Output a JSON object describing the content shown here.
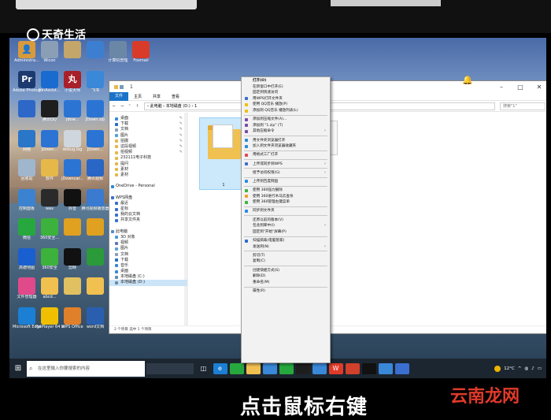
{
  "watermark": {
    "top_left": "天奇生活",
    "bottom_right": "云南龙网"
  },
  "caption": "点击鼠标右键",
  "desktop_icons": [
    {
      "label": "Administra...",
      "color": "#d89a3a",
      "glyph": "👤",
      "col": 0,
      "row": 0
    },
    {
      "label": "Wicon",
      "color": "#8a9fb5",
      "glyph": "",
      "col": 1,
      "row": 0
    },
    {
      "label": "",
      "color": "#c4a56a",
      "glyph": "",
      "col": 2,
      "row": 0
    },
    {
      "label": "",
      "color": "#3c7fd0",
      "glyph": "",
      "col": 3,
      "row": 0
    },
    {
      "label": "计算机管理",
      "color": "#6b87a6",
      "glyph": "",
      "col": 4,
      "row": 0
    },
    {
      "label": "Foxmail",
      "color": "#d83b2a",
      "glyph": "",
      "col": 5,
      "row": 0
    },
    {
      "label": "Adobe Photosho...",
      "color": "#1d3a70",
      "glyph": "Pr",
      "col": 0,
      "row": 1
    },
    {
      "label": "JdnAssist...",
      "color": "#1a6bd0",
      "glyph": "",
      "col": 1,
      "row": 1
    },
    {
      "label": "小说大师",
      "color": "#a8202a",
      "glyph": "丸",
      "col": 2,
      "row": 1
    },
    {
      "label": "飞书",
      "color": "#3a88d8",
      "glyph": "",
      "col": 3,
      "row": 1
    },
    {
      "label": "",
      "color": "#2d68c8",
      "glyph": "",
      "col": 0,
      "row": 2
    },
    {
      "label": "腾讯QQ",
      "color": "#1e1e1e",
      "glyph": "",
      "col": 1,
      "row": 2
    },
    {
      "label": "jdow...",
      "color": "#2b74d4",
      "glyph": "",
      "col": 2,
      "row": 2
    },
    {
      "label": "JDown.zip",
      "color": "#2b74d4",
      "glyph": "",
      "col": 3,
      "row": 2
    },
    {
      "label": "网络",
      "color": "#2a76c8",
      "glyph": "",
      "col": 0,
      "row": 3
    },
    {
      "label": "JDown...",
      "color": "#2b74d4",
      "glyph": "",
      "col": 1,
      "row": 3
    },
    {
      "label": "debug.log",
      "color": "#cfd6de",
      "glyph": "",
      "col": 2,
      "row": 3
    },
    {
      "label": "JDown...",
      "color": "#2b74d4",
      "glyph": "",
      "col": 3,
      "row": 3
    },
    {
      "label": "回收站",
      "color": "#9fb6cc",
      "glyph": "",
      "col": 0,
      "row": 4
    },
    {
      "label": "软件",
      "color": "#e6b84a",
      "glyph": "",
      "col": 1,
      "row": 4
    },
    {
      "label": "JDowncar...",
      "color": "#2b74d4",
      "glyph": "",
      "col": 2,
      "row": 4
    },
    {
      "label": "腾讯视频",
      "color": "#2a66c6",
      "glyph": "",
      "col": 3,
      "row": 4
    },
    {
      "label": "控制面板",
      "color": "#3b83d0",
      "glyph": "",
      "col": 0,
      "row": 5
    },
    {
      "label": "wav",
      "color": "#2a2a2a",
      "glyph": "",
      "col": 1,
      "row": 5
    },
    {
      "label": "抖音",
      "color": "#111111",
      "glyph": "",
      "col": 2,
      "row": 5
    },
    {
      "label": "腾讯视频播放器",
      "color": "#3a7ad0",
      "glyph": "",
      "col": 3,
      "row": 5
    },
    {
      "label": "微信",
      "color": "#27a83e",
      "glyph": "",
      "col": 0,
      "row": 6
    },
    {
      "label": "360安全...",
      "color": "#3cb23c",
      "glyph": "",
      "col": 1,
      "row": 6
    },
    {
      "label": "",
      "color": "#e0a020",
      "glyph": "",
      "col": 2,
      "row": 6
    },
    {
      "label": "",
      "color": "#e0a020",
      "glyph": "",
      "col": 3,
      "row": 6
    },
    {
      "label": "高德地图",
      "color": "#1a5fd0",
      "glyph": "",
      "col": 0,
      "row": 7
    },
    {
      "label": "360安全",
      "color": "#3cb23c",
      "glyph": "",
      "col": 1,
      "row": 7
    },
    {
      "label": "剪映",
      "color": "#111111",
      "glyph": "",
      "col": 2,
      "row": 7
    },
    {
      "label": "",
      "color": "#2a9a3a",
      "glyph": "",
      "col": 3,
      "row": 7
    },
    {
      "label": "文件管理器",
      "color": "#e04a8a",
      "glyph": "",
      "col": 0,
      "row": 8
    },
    {
      "label": "abcd...",
      "color": "#f0c050",
      "glyph": "",
      "col": 1,
      "row": 8
    },
    {
      "label": "",
      "color": "#e0c060",
      "glyph": "",
      "col": 2,
      "row": 8
    },
    {
      "label": "",
      "color": "#f0c050",
      "glyph": "",
      "col": 3,
      "row": 8
    },
    {
      "label": "Microsoft Edge",
      "color": "#1b7fd4",
      "glyph": "",
      "col": 0,
      "row": 9
    },
    {
      "label": "PotPlayer 64 bit",
      "color": "#f0c000",
      "glyph": "",
      "col": 1,
      "row": 9
    },
    {
      "label": "WPS Office",
      "color": "#e0802a",
      "glyph": "",
      "col": 2,
      "row": 9
    },
    {
      "label": "word文档",
      "color": "#2a5fb0",
      "glyph": "",
      "col": 3,
      "row": 9
    }
  ],
  "explorer": {
    "title": "1",
    "ribbon_tabs": [
      "文件",
      "主页",
      "共享",
      "查看"
    ],
    "address_path": "› 此电脑 › 本地磁盘 (D:) › 1",
    "search_placeholder": "搜索\"1\"",
    "nav_items": [
      {
        "label": "桌面",
        "color": "#3a88d8",
        "sec": false,
        "pin": true
      },
      {
        "label": "下载",
        "color": "#2a6bc8",
        "sec": false,
        "pin": true
      },
      {
        "label": "文档",
        "color": "#8a9fb5",
        "sec": false,
        "pin": true
      },
      {
        "label": "图片",
        "color": "#5aa0d8",
        "sec": false,
        "pin": true
      },
      {
        "label": "拍摄",
        "color": "#e6b84a",
        "sec": false,
        "pin": true
      },
      {
        "label": "这段视频",
        "color": "#e6b84a",
        "sec": false,
        "pin": true
      },
      {
        "label": "拍视频",
        "color": "#e6b84a",
        "sec": false,
        "pin": true
      },
      {
        "label": "232111电子科技",
        "color": "#e6b84a",
        "sec": false,
        "pin": false
      },
      {
        "label": "提问",
        "color": "#e6b84a",
        "sec": false,
        "pin": false
      },
      {
        "label": "素材",
        "color": "#e6b84a",
        "sec": false,
        "pin": false
      },
      {
        "label": "素材",
        "color": "#e6b84a",
        "sec": false,
        "pin": false
      },
      {
        "label": "",
        "color": "transparent",
        "sec": false,
        "pin": false
      },
      {
        "label": "OneDrive - Personal",
        "color": "#2a8ad8",
        "sec": true,
        "pin": false
      },
      {
        "label": "",
        "color": "transparent",
        "sec": false,
        "pin": false
      },
      {
        "label": "WPS网盘",
        "color": "#3a6fd0",
        "sec": true,
        "pin": false
      },
      {
        "label": "最近",
        "color": "#3a6fd0",
        "sec": false,
        "pin": false
      },
      {
        "label": "星标",
        "color": "#3a6fd0",
        "sec": false,
        "pin": false
      },
      {
        "label": "我的云文档",
        "color": "#3a6fd0",
        "sec": false,
        "pin": false
      },
      {
        "label": "共享文件夹",
        "color": "#3a6fd0",
        "sec": false,
        "pin": false
      },
      {
        "label": "",
        "color": "transparent",
        "sec": false,
        "pin": false
      },
      {
        "label": "此电脑",
        "color": "#5a8ac8",
        "sec": true,
        "pin": false
      },
      {
        "label": "3D 对象",
        "color": "#4a9ad8",
        "sec": false,
        "pin": false
      },
      {
        "label": "视频",
        "color": "#5a7ab8",
        "sec": false,
        "pin": false
      },
      {
        "label": "图片",
        "color": "#5aa0d8",
        "sec": false,
        "pin": false
      },
      {
        "label": "文档",
        "color": "#8a9fb5",
        "sec": false,
        "pin": false
      },
      {
        "label": "下载",
        "color": "#2a6bc8",
        "sec": false,
        "pin": false
      },
      {
        "label": "音乐",
        "color": "#3a88d8",
        "sec": false,
        "pin": false
      },
      {
        "label": "桌面",
        "color": "#3a88d8",
        "sec": false,
        "pin": false
      },
      {
        "label": "本地磁盘 (C:)",
        "color": "#6a8aa8",
        "sec": false,
        "pin": false
      },
      {
        "label": "本地磁盘 (D:)",
        "color": "#6a8aa8",
        "sec": false,
        "pin": false,
        "selected": true
      }
    ],
    "folder_label": "1",
    "status": "2 个项目   选中 1 个项目"
  },
  "context_menu": [
    {
      "type": "item",
      "label": "打开(O)",
      "bold": true
    },
    {
      "type": "item",
      "label": "在新窗口中打开(E)"
    },
    {
      "type": "item",
      "label": "固定到快速访问"
    },
    {
      "type": "item",
      "label": "用WPS打开文件夹",
      "icon": "#3a6fd0"
    },
    {
      "type": "item",
      "label": "使用 QQ音乐 播放(P)",
      "icon": "#f0c000"
    },
    {
      "type": "item",
      "label": "添加到 QQ音乐 播放列表(L)",
      "icon": "#f0c000"
    },
    {
      "type": "sep"
    },
    {
      "type": "item",
      "label": "添加到压缩文件(A)...",
      "icon": "#7a4aa8"
    },
    {
      "type": "item",
      "label": "添加到 \"1.zip\" (T)",
      "icon": "#7a4aa8"
    },
    {
      "type": "item",
      "label": "其他压缩命令",
      "icon": "#7a4aa8",
      "arrow": true
    },
    {
      "type": "sep"
    },
    {
      "type": "item",
      "label": "用文件夹浏览器打开",
      "icon": "#2a8ad8"
    },
    {
      "type": "item",
      "label": "加入到文件夹浏览器收藏夹",
      "icon": "#2a8ad8"
    },
    {
      "type": "sep"
    },
    {
      "type": "item",
      "label": "用格式工厂打开",
      "icon": "#e04a4a"
    },
    {
      "type": "sep"
    },
    {
      "type": "item",
      "label": "上传或同步到WPS",
      "icon": "#3a6fd0",
      "arrow": true
    },
    {
      "type": "sep"
    },
    {
      "type": "item",
      "label": "授予访问权限(G)",
      "arrow": true
    },
    {
      "type": "sep"
    },
    {
      "type": "item",
      "label": "上传到百度网盘",
      "icon": "#2a88e8"
    },
    {
      "type": "sep"
    },
    {
      "type": "item",
      "label": "使用 360强力删除",
      "icon": "#3cb23c"
    },
    {
      "type": "item",
      "label": "使用 360进行木马云查杀",
      "icon": "#f0a020"
    },
    {
      "type": "item",
      "label": "使用 360管理右键菜单",
      "icon": "#3cb23c"
    },
    {
      "type": "sep"
    },
    {
      "type": "item",
      "label": "同步到文件夹",
      "icon": "#2a88e8"
    },
    {
      "type": "sep"
    },
    {
      "type": "item",
      "label": "还原以前的版本(V)"
    },
    {
      "type": "item",
      "label": "包含到库中(I)",
      "arrow": true
    },
    {
      "type": "item",
      "label": "固定到\"开始\"屏幕(P)"
    },
    {
      "type": "sep"
    },
    {
      "type": "item",
      "label": "扫描病毒(电脑管家)",
      "icon": "#2a6bd0"
    },
    {
      "type": "item",
      "label": "发送到(N)",
      "arrow": true
    },
    {
      "type": "sep"
    },
    {
      "type": "item",
      "label": "剪切(T)"
    },
    {
      "type": "item",
      "label": "复制(C)"
    },
    {
      "type": "sep"
    },
    {
      "type": "item",
      "label": "创建快捷方式(S)"
    },
    {
      "type": "item",
      "label": "删除(D)"
    },
    {
      "type": "item",
      "label": "重命名(M)"
    },
    {
      "type": "sep"
    },
    {
      "type": "item",
      "label": "属性(R)"
    }
  ],
  "taskbar": {
    "search_placeholder": "在这里输入你要搜索的内容",
    "apps": [
      {
        "name": "task-view-icon",
        "color": "transparent",
        "glyph": "◫"
      },
      {
        "name": "edge-icon",
        "color": "#1b7fd4",
        "glyph": "e"
      },
      {
        "name": "wechat-icon",
        "color": "#27a83e",
        "glyph": ""
      },
      {
        "name": "explorer-icon",
        "color": "#f0c050",
        "glyph": ""
      },
      {
        "name": "store-icon",
        "color": "#3a88d8",
        "glyph": ""
      },
      {
        "name": "chat-icon",
        "color": "#27a83e",
        "glyph": ""
      },
      {
        "name": "qq-icon",
        "color": "#1e1e1e",
        "glyph": ""
      },
      {
        "name": "feishu-icon",
        "color": "#3a88d8",
        "glyph": ""
      },
      {
        "name": "wps-icon",
        "color": "#e03a2a",
        "glyph": "W"
      },
      {
        "name": "office-icon",
        "color": "#d0402a",
        "glyph": ""
      },
      {
        "name": "capcut-icon",
        "color": "#111111",
        "glyph": ""
      },
      {
        "name": "media-icon",
        "color": "#3a88d8",
        "glyph": ""
      },
      {
        "name": "app-icon",
        "color": "#3a6fd0",
        "glyph": ""
      }
    ],
    "weather": "12°C",
    "time": ""
  }
}
